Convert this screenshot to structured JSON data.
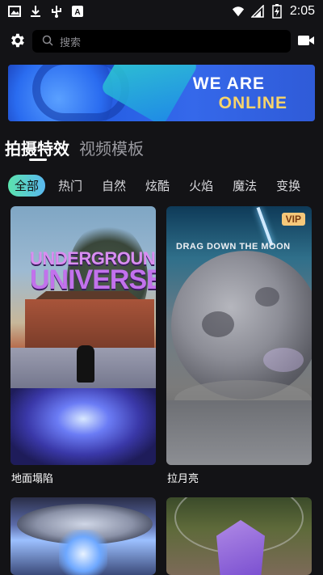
{
  "status_bar": {
    "time": "2:05",
    "left_icons": [
      "image-icon",
      "download-icon",
      "usb-icon",
      "app-a-icon"
    ],
    "right_icons": [
      "wifi-icon",
      "signal-icon",
      "battery-charging-icon"
    ]
  },
  "top_bar": {
    "search_placeholder": "搜索",
    "left_icon": "gear-icon",
    "right_icon": "video-camera-icon"
  },
  "banner": {
    "line1": "WE ARE",
    "line2": "ONLINE",
    "line2_color": "#f8d46a"
  },
  "main_tabs": [
    {
      "label": "拍摄特效",
      "active": true
    },
    {
      "label": "视频模板",
      "active": false
    }
  ],
  "categories": [
    {
      "label": "全部",
      "active": true
    },
    {
      "label": "热门"
    },
    {
      "label": "自然"
    },
    {
      "label": "炫酷"
    },
    {
      "label": "火焰"
    },
    {
      "label": "魔法"
    },
    {
      "label": "变换"
    }
  ],
  "cards": [
    {
      "title": "地面塌陷",
      "overlay_line1": "UNDERGROUND",
      "overlay_line2": "UNIVERSE",
      "vip": false
    },
    {
      "title": "拉月亮",
      "overlay_line1": "DRAG DOWN THE MOON",
      "vip": true,
      "vip_label": "VIP"
    },
    {
      "title": "",
      "vip": false
    },
    {
      "title": "",
      "vip": false
    }
  ],
  "colors": {
    "background": "#131316",
    "accent_gradient_start": "#5be3ad",
    "accent_gradient_end": "#5ab8f0",
    "vip_badge": "#f5c87a"
  }
}
